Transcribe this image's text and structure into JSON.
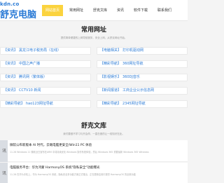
{
  "header": {
    "logo_url": "kdn.co",
    "logo_name": "舒克电脑",
    "nav": [
      {
        "label": "网站首页",
        "active": true
      },
      {
        "label": "常用网址",
        "active": false
      },
      {
        "label": "舒克文库",
        "active": false
      },
      {
        "label": "资讯",
        "active": false
      },
      {
        "label": "软件下载",
        "active": false
      },
      {
        "label": "联系我们",
        "active": false
      }
    ]
  },
  "links_section": {
    "title": "常用网址",
    "subtitle": "提供简单便捷的上网导航服务，安全上网，从舒克网址开始。",
    "items": [
      {
        "prefix": "【资讯】",
        "text": "黑龙江电子税务局（在线）"
      },
      {
        "prefix": "【电脑相关】",
        "text": "打印机驱动网"
      },
      {
        "prefix": "【资讯】",
        "text": "中国之声广播"
      },
      {
        "prefix": "【精彩导航】",
        "text": "360网址导航"
      },
      {
        "prefix": "【资讯】",
        "text": "腾讯网（繁体版）"
      },
      {
        "prefix": "【影视娱乐】",
        "text": "360DJ音乐"
      },
      {
        "prefix": "【资讯】",
        "text": "CCTV10 新闻"
      },
      {
        "prefix": "【新闻报道】",
        "text": "工商企业公示信息网"
      },
      {
        "prefix": "【精彩导航】",
        "text": "hao123网址导航"
      },
      {
        "prefix": "【精彩导航】",
        "text": "2345网址导航"
      }
    ]
  },
  "library_section": {
    "title": "舒克文库",
    "subtitle": "我们要做不学习与开会停，一直在做的让一线知识在此。",
    "articles": [
      {
        "thumb": "讯",
        "title": "微软公布新版本 AI 时代，云端电脑更安全/Win11 PC 体验",
        "meta": "11.28 Windows 11 微软近日宣布在ARM 中将持续优化 Windows 操作系统体验，然后 Windows 365 重要最新 Windows 365 Windows"
      },
      {
        "thumb": "讯",
        "title": "电脑服务平台：华为鸿蒙 HarmonyOS 系统\"隐私安全\"功能曝光",
        "meta": "11.28 在华为手机上，华为 HarmonyOS 系统，隐私安全多功能方案正式推出，正在更新应用中提供 HarmonyOS 的全新功能"
      }
    ]
  }
}
